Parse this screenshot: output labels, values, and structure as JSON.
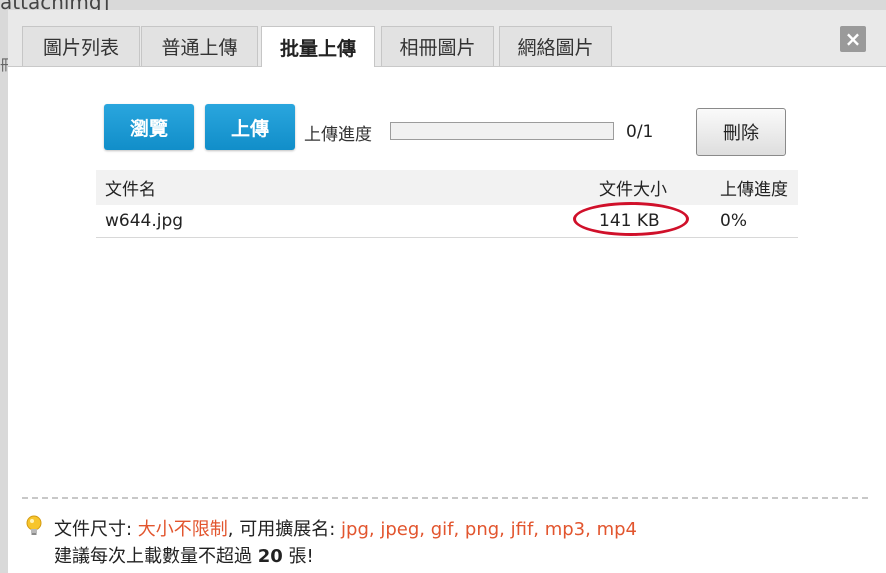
{
  "background": {
    "top_text": "attachimg]",
    "left_text": "冊"
  },
  "tabs": [
    {
      "label": "圖片列表",
      "active": false
    },
    {
      "label": "普通上傳",
      "active": false
    },
    {
      "label": "批量上傳",
      "active": true
    },
    {
      "label": "相冊圖片",
      "active": false
    },
    {
      "label": "網絡圖片",
      "active": false
    }
  ],
  "close_label": "×",
  "toolbar": {
    "browse_label": "瀏覽",
    "upload_label": "上傳",
    "progress_label": "上傳進度",
    "progress_value": 0,
    "progress_count": "0/1",
    "delete_label": "刪除"
  },
  "table": {
    "headers": {
      "name": "文件名",
      "size": "文件大小",
      "progress": "上傳進度"
    },
    "rows": [
      {
        "name": "w644.jpg",
        "size": "141 KB",
        "progress": "0%"
      }
    ]
  },
  "footer": {
    "size_label": "文件尺寸: ",
    "size_value": "大小不限制",
    "ext_label": ", 可用擴展名: ",
    "ext_value": "jpg, jpeg, gif, png, jfif, mp3, mp4",
    "advice_prefix": "建議每次上載數量不超過 ",
    "advice_count": "20",
    "advice_suffix": " 張!"
  },
  "colors": {
    "accent": "#1a9cd8",
    "highlight": "#e2552e",
    "annotation": "#d0102a"
  }
}
